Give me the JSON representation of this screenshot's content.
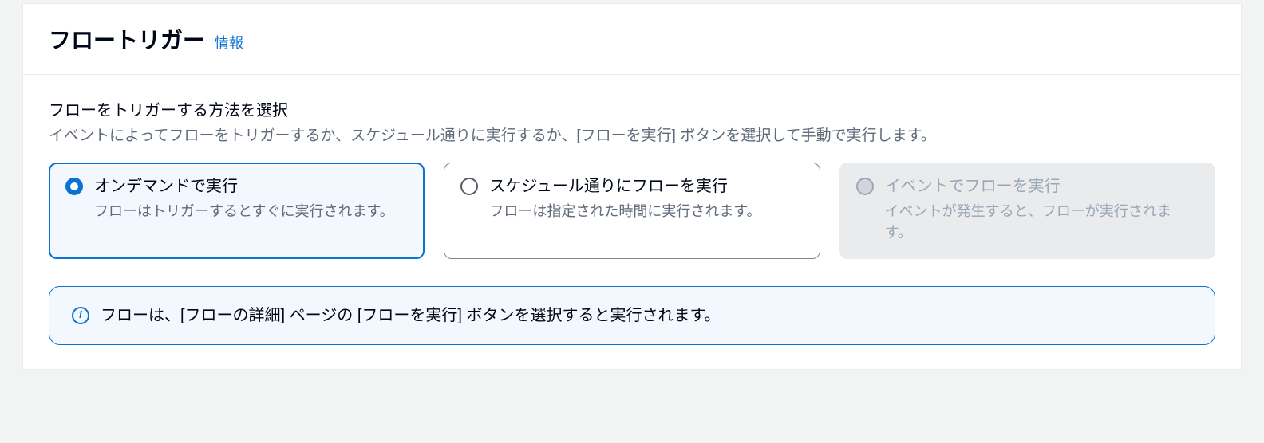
{
  "header": {
    "title": "フロートリガー",
    "info_link": "情報"
  },
  "section": {
    "label": "フローをトリガーする方法を選択",
    "description": "イベントによってフローをトリガーするか、スケジュール通りに実行するか、[フローを実行] ボタンを選択して手動で実行します。"
  },
  "options": [
    {
      "title": "オンデマンドで実行",
      "description": "フローはトリガーするとすぐに実行されます。",
      "state": "selected"
    },
    {
      "title": "スケジュール通りにフローを実行",
      "description": "フローは指定された時間に実行されます。",
      "state": "default"
    },
    {
      "title": "イベントでフローを実行",
      "description": "イベントが発生すると、フローが実行されます。",
      "state": "disabled"
    }
  ],
  "info_box": {
    "text": "フローは、[フローの詳細] ページの [フローを実行] ボタンを選択すると実行されます。"
  }
}
